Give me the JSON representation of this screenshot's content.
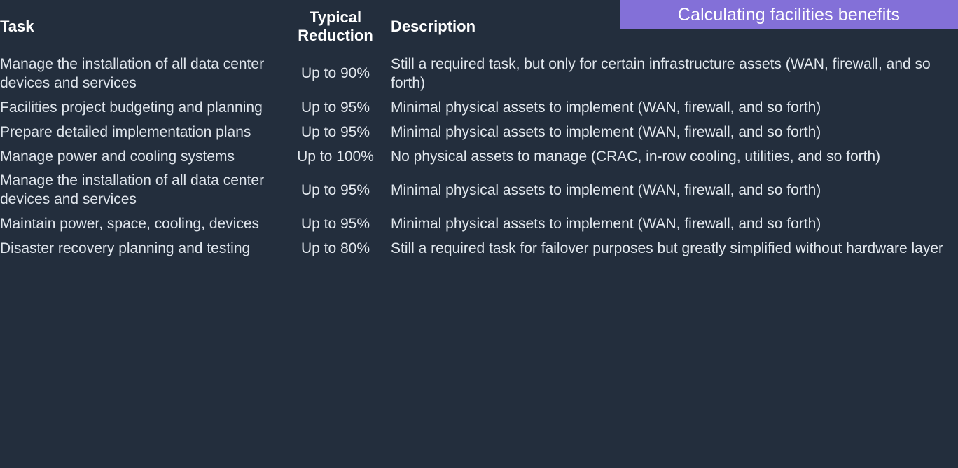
{
  "title_banner": {
    "text": "Calculating facilities benefits",
    "background_color": "#8370d8",
    "text_color": "#ffffff"
  },
  "theme": {
    "background_color": "#232e3d",
    "text_color": "#e8ecf1",
    "accent_color": "#8370d8"
  },
  "table": {
    "headers": {
      "task": "Task",
      "reduction": "Typical Reduction",
      "description": "Description"
    },
    "rows": [
      {
        "task": "Manage the installation of all data center devices and services",
        "reduction": "Up to 90%",
        "description": "Still a required task, but only for certain infrastructure assets (WAN, firewall, and so forth)"
      },
      {
        "task": "Facilities project budgeting and planning",
        "reduction": "Up to 95%",
        "description": "Minimal physical assets to implement (WAN, firewall, and so forth)"
      },
      {
        "task": "Prepare detailed implementation plans",
        "reduction": "Up to 95%",
        "description": "Minimal physical assets to implement (WAN, firewall, and so forth)"
      },
      {
        "task": "Manage power and cooling systems",
        "reduction": "Up to 100%",
        "description": "No physical assets to manage (CRAC, in-row cooling, utilities, and so forth)"
      },
      {
        "task": "Manage the installation of all data center devices and services",
        "reduction": "Up to 95%",
        "description": "Minimal physical assets to implement (WAN, firewall, and so forth)"
      },
      {
        "task": "Maintain power, space, cooling, devices",
        "reduction": "Up to 95%",
        "description": "Minimal physical assets to implement (WAN, firewall, and so forth)"
      },
      {
        "task": "Disaster recovery planning and testing",
        "reduction": "Up to 80%",
        "description": "Still a required task for failover purposes but greatly simplified without hardware layer"
      }
    ]
  }
}
